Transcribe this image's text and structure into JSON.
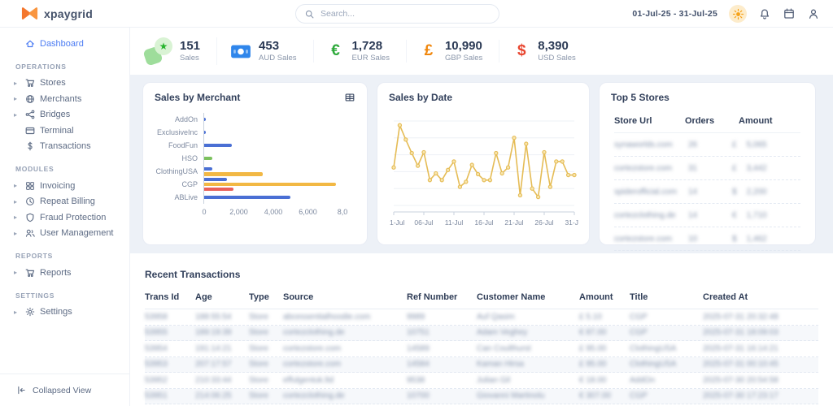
{
  "header": {
    "brand": "xpaygrid",
    "search_placeholder": "Search...",
    "date_range": "01-Jul-25 - 31-Jul-25"
  },
  "sidebar": {
    "dashboard": {
      "label": "Dashboard",
      "icon": "home",
      "chevron": false,
      "active": true
    },
    "groups": [
      {
        "header": "OPERATIONS",
        "items": [
          {
            "label": "Stores",
            "icon": "cart",
            "chevron": true
          },
          {
            "label": "Merchants",
            "icon": "globe",
            "chevron": true
          },
          {
            "label": "Bridges",
            "icon": "share",
            "chevron": true
          },
          {
            "label": "Terminal",
            "icon": "credit-card",
            "chevron": false
          },
          {
            "label": "Transactions",
            "icon": "dollar",
            "chevron": false
          }
        ]
      },
      {
        "header": "MODULES",
        "items": [
          {
            "label": "Invoicing",
            "icon": "grid",
            "chevron": true
          },
          {
            "label": "Repeat Billing",
            "icon": "clock",
            "chevron": true
          },
          {
            "label": "Fraud Protection",
            "icon": "shield",
            "chevron": true
          },
          {
            "label": "User Management",
            "icon": "users",
            "chevron": true
          }
        ]
      },
      {
        "header": "REPORTS",
        "items": [
          {
            "label": "Reports",
            "icon": "cart",
            "chevron": true
          }
        ]
      },
      {
        "header": "SETTINGS",
        "items": [
          {
            "label": "Settings",
            "icon": "gear",
            "chevron": true
          }
        ]
      }
    ],
    "collapse_label": "Collapsed View"
  },
  "stats": [
    {
      "icon": "sales-badge",
      "value": "151",
      "label": "Sales"
    },
    {
      "icon": "banknote",
      "value": "453",
      "label": "AUD Sales"
    },
    {
      "icon": "euro-sign",
      "sym": "€",
      "color": "#2faa3c",
      "value": "1,728",
      "label": "EUR Sales"
    },
    {
      "icon": "pound-sign",
      "sym": "£",
      "color": "#f0860b",
      "value": "10,990",
      "label": "GBP Sales"
    },
    {
      "icon": "dollar-sign",
      "sym": "$",
      "color": "#e8442e",
      "value": "8,390",
      "label": "USD Sales"
    }
  ],
  "chart_data": [
    {
      "type": "bar",
      "orientation": "horizontal",
      "title": "Sales by Merchant",
      "xlim": [
        0,
        8000
      ],
      "xticks": [
        "0",
        "2,000",
        "4,000",
        "6,000",
        "8,0"
      ],
      "grid": false,
      "groups": [
        {
          "label": "AddOn",
          "bars": [
            {
              "color": "#4a6fd4",
              "value": 60
            }
          ]
        },
        {
          "label": "ExclusiveInc",
          "bars": [
            {
              "color": "#4a6fd4",
              "value": 90
            }
          ]
        },
        {
          "label": "FoodFun",
          "bars": [
            {
              "color": "#4a6fd4",
              "value": 1600
            }
          ]
        },
        {
          "label": "HSO",
          "bars": [
            {
              "color": "#7cc15e",
              "value": 450
            }
          ]
        },
        {
          "label": "ClothingUSA",
          "bars": [
            {
              "color": "#4a6fd4",
              "value": 450
            },
            {
              "color": "#f2b844",
              "value": 3400
            }
          ]
        },
        {
          "label": "CGP",
          "bars": [
            {
              "color": "#4a6fd4",
              "value": 1300
            },
            {
              "color": "#f2b844",
              "value": 7600
            },
            {
              "color": "#e9605a",
              "value": 1700
            }
          ]
        },
        {
          "label": "ABLive",
          "bars": [
            {
              "color": "#4a6fd4",
              "value": 5000
            }
          ]
        }
      ]
    },
    {
      "type": "line",
      "title": "Sales by Date",
      "color": "#e5bc56",
      "marker_fill": "#f8e5ad",
      "ylim": [
        0,
        100
      ],
      "grid": true,
      "x_days": [
        1,
        2,
        3,
        4,
        5,
        6,
        7,
        8,
        9,
        10,
        11,
        12,
        13,
        14,
        15,
        16,
        17,
        18,
        19,
        20,
        21,
        22,
        23,
        24,
        25,
        26,
        27,
        28,
        29,
        30,
        31
      ],
      "values": [
        45,
        95,
        78,
        62,
        47,
        63,
        30,
        38,
        30,
        42,
        52,
        22,
        28,
        48,
        37,
        30,
        30,
        62,
        38,
        45,
        80,
        12,
        73,
        20,
        10,
        63,
        22,
        52,
        52,
        36,
        36
      ],
      "xticks": [
        {
          "day": 1,
          "label": "1-Jul"
        },
        {
          "day": 6,
          "label": "06-Jul"
        },
        {
          "day": 11,
          "label": "11-Jul"
        },
        {
          "day": 16,
          "label": "16-Jul"
        },
        {
          "day": 21,
          "label": "21-Jul"
        },
        {
          "day": 26,
          "label": "26-Jul"
        },
        {
          "day": 31,
          "label": "31-J"
        }
      ]
    }
  ],
  "top_stores": {
    "title": "Top 5 Stores",
    "headers": [
      "Store Url",
      "Orders",
      "Amount"
    ],
    "rows": [
      {
        "url": "synaworlds.com",
        "orders": "26",
        "cur": "£",
        "amount": "5,065"
      },
      {
        "url": "cortezstore.com",
        "orders": "31",
        "cur": "£",
        "amount": "3,442"
      },
      {
        "url": "spiderofficial.com",
        "orders": "14",
        "cur": "$",
        "amount": "2,200"
      },
      {
        "url": "cortezclothing.de",
        "orders": "14",
        "cur": "€",
        "amount": "1,710"
      },
      {
        "url": "cortezstore.com",
        "orders": "10",
        "cur": "$",
        "amount": "1,462"
      }
    ]
  },
  "transactions": {
    "title": "Recent Transactions",
    "headers": [
      "Trans Id",
      "Age",
      "Type",
      "Source",
      "Ref Number",
      "Customer Name",
      "Amount",
      "Title",
      "Created At"
    ],
    "rows": [
      [
        "53958",
        "188:55:54",
        "Store",
        "abcessentialhoodie.com",
        "9989",
        "Auf Qasim",
        "£ 5.10",
        "CGP",
        "2025-07-31 20:32:48"
      ],
      [
        "53955",
        "189:19:39",
        "Store",
        "cortezclothing.de",
        "10751",
        "Adam Veghey",
        "€ 87.00",
        "CGP",
        "2025-07-31 18:09:03"
      ],
      [
        "53954",
        "191:14:21",
        "Store",
        "cortezstore.com",
        "14589",
        "Can Coulthurst",
        "£ 95.00",
        "ClothingUSA",
        "2025-07-31 16:14:21"
      ],
      [
        "53953",
        "207:17:57",
        "Store",
        "cortezstore.com",
        "14584",
        "Kaman Hirsa",
        "£ 95.00",
        "ClothingUSA",
        "2025-07-31 00:10:45"
      ],
      [
        "53952",
        "210:33:44",
        "Store",
        "effulgentuk.ltd",
        "9538",
        "Julian Gil",
        "€ 18.00",
        "AddOn",
        "2025-07-30 20:54:58"
      ],
      [
        "53951",
        "214:06:25",
        "Store",
        "cortezclothing.de",
        "10700",
        "Giovanni Martinolu",
        "€ 307.00",
        "CGP",
        "2025-07-30 17:23:17"
      ]
    ]
  },
  "colors": {
    "accent_blue": "#4c7cf3",
    "logo_orange": "#f4772e",
    "band_bg": "#edf1f7",
    "bar_blue": "#4a6fd4",
    "bar_yellow": "#f2b844",
    "bar_red": "#e9605a",
    "bar_green": "#7cc15e",
    "line_gold": "#e5bc56"
  }
}
